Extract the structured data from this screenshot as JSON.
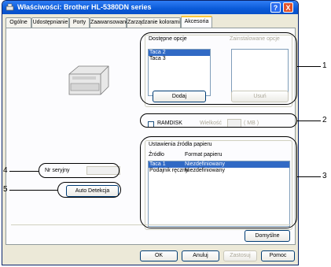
{
  "window": {
    "title": "Właściwości: Brother HL-5380DN series",
    "help_btn": "?",
    "close_btn": "X"
  },
  "tabs": [
    "Ogólne",
    "Udostępnianie",
    "Porty",
    "Zaawansowane",
    "Zarządzanie kolorami",
    "Akcesoria"
  ],
  "available_options": {
    "label": "Dostępne opcje",
    "items": [
      "Taca 2",
      "Taca 3"
    ],
    "add_button": "Dodaj"
  },
  "installed_options": {
    "label": "Zainstalowane opcje",
    "items": [],
    "remove_button": "Usuń"
  },
  "ramdisk": {
    "label": "RAMDISK",
    "checked": false,
    "size_label": "Wielkość",
    "unit": "( MB )"
  },
  "paper_source": {
    "group_title": "Ustawienia źródła papieru",
    "col_source": "Źródło",
    "col_format": "Format papieru",
    "rows": [
      {
        "source": "Taca 1",
        "format": "Niezdefiniowany",
        "selected": true
      },
      {
        "source": "Podajnik ręczny",
        "format": "Niezdefiniowany",
        "selected": false
      }
    ]
  },
  "serial": {
    "label": "Nr seryjny",
    "value": ""
  },
  "auto_detect_button": "Auto Detekcja",
  "default_button": "Domyślne",
  "footer": {
    "ok": "OK",
    "cancel": "Anuluj",
    "apply": "Zastosuj",
    "help": "Pomoc"
  },
  "callouts": [
    "1",
    "2",
    "3",
    "4",
    "5"
  ]
}
